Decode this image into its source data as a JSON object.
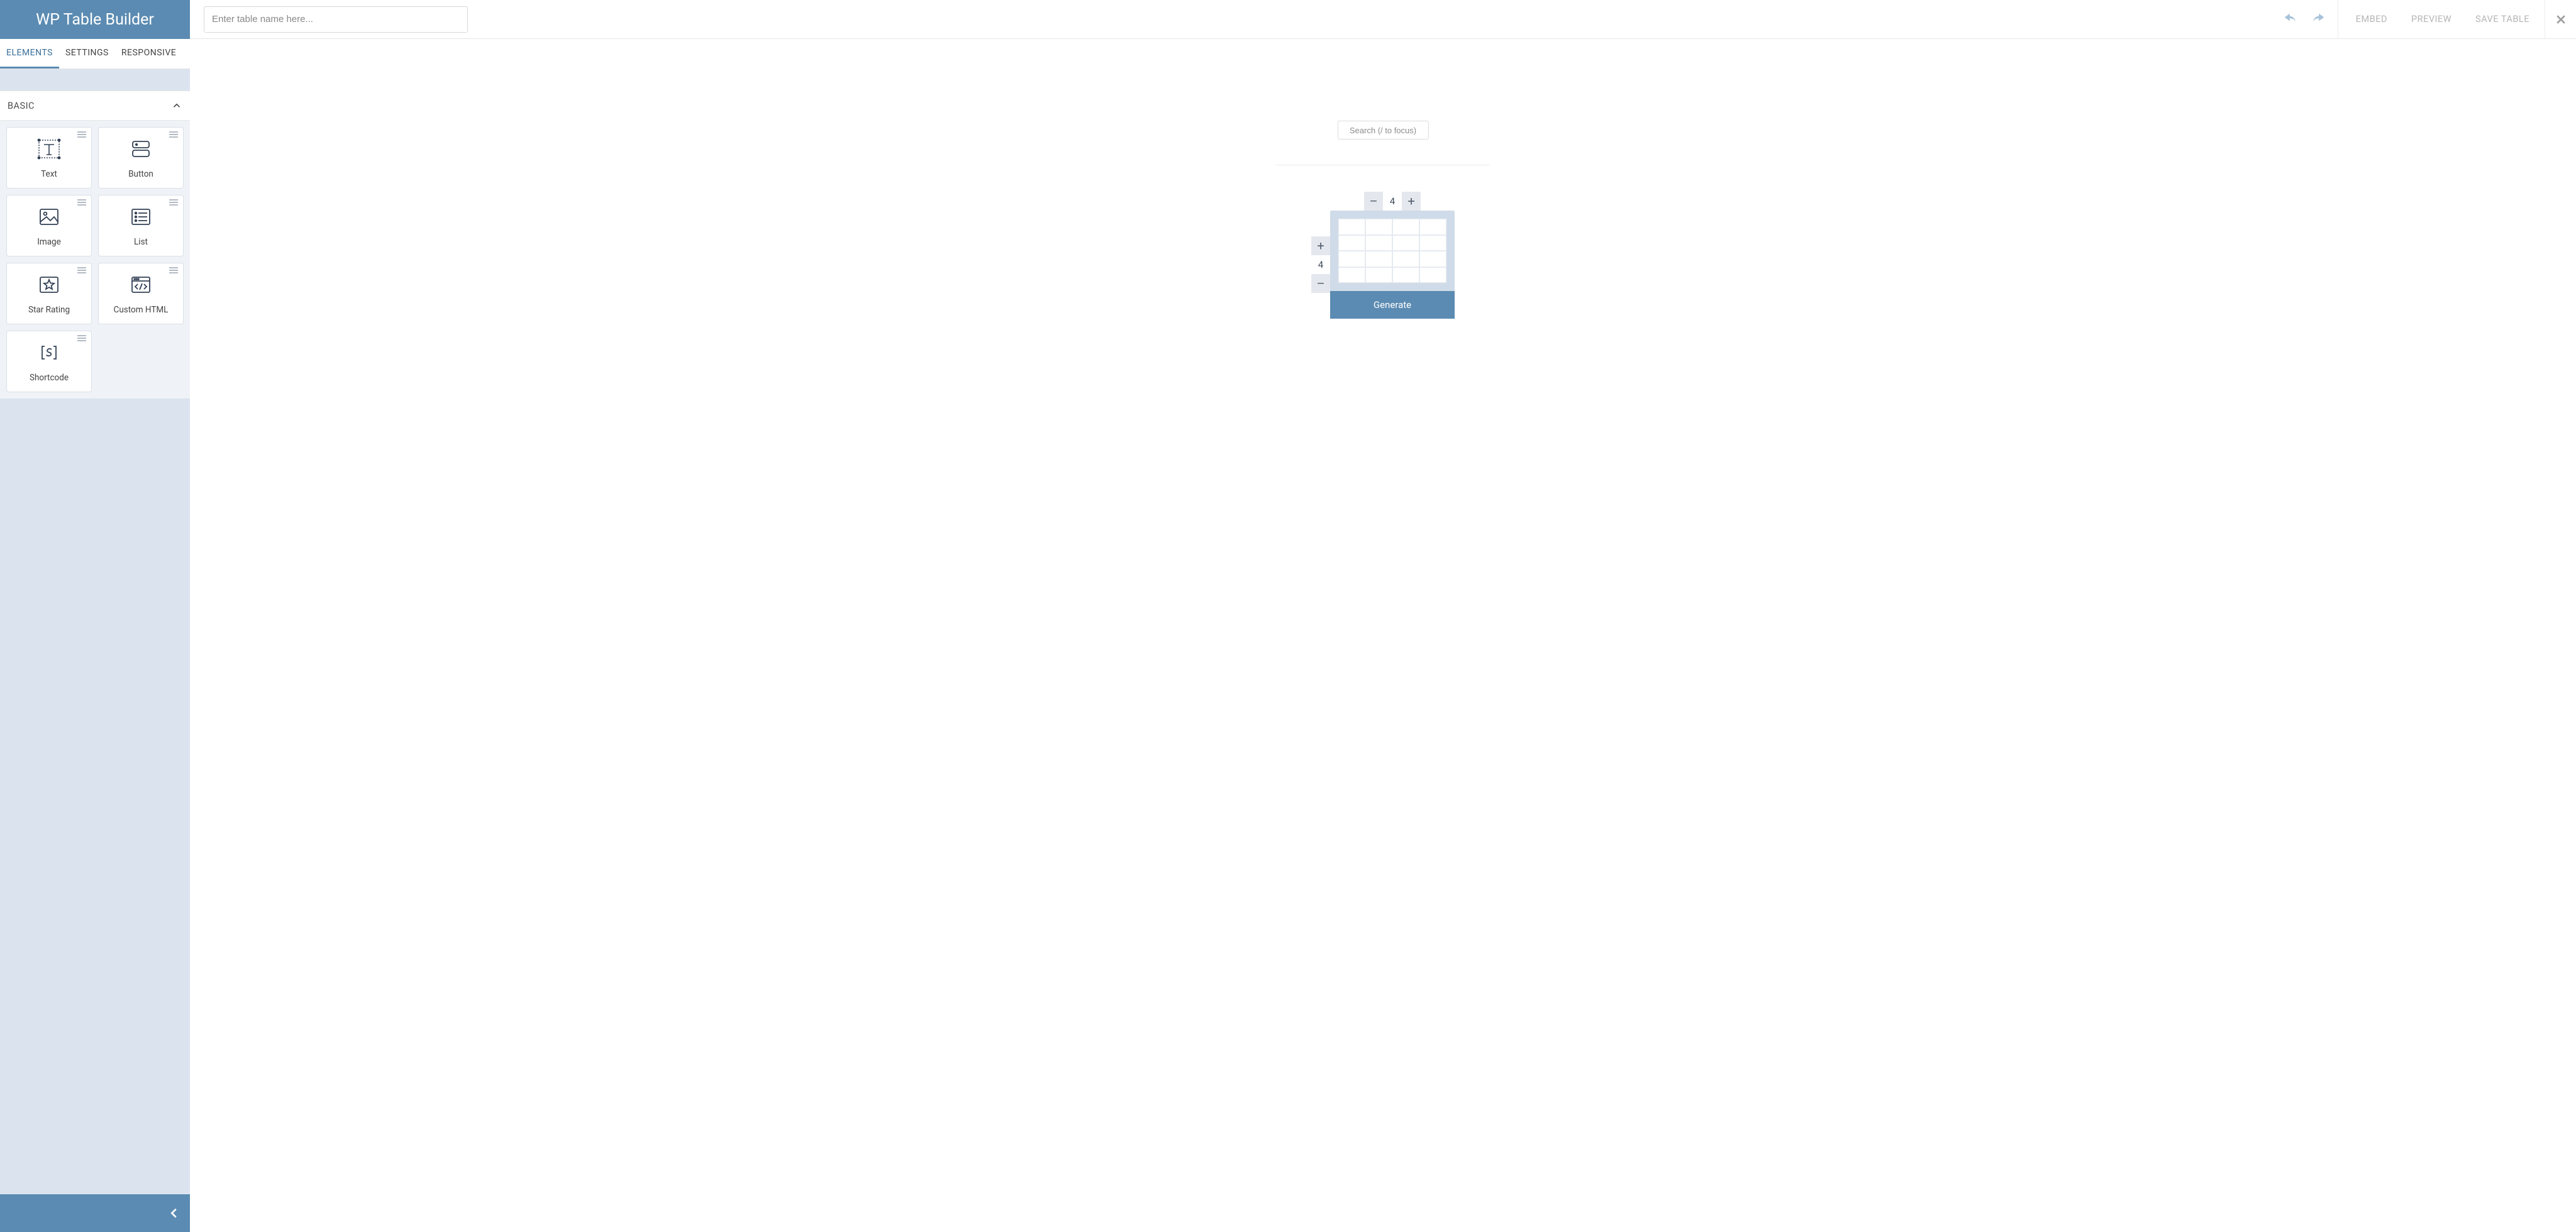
{
  "app": {
    "title": "WP Table Builder"
  },
  "sidebar": {
    "tabs": {
      "elements": "ELEMENTS",
      "settings": "SETTINGS",
      "responsive": "RESPONSIVE"
    },
    "panel_title": "BASIC",
    "elements": {
      "text": "Text",
      "button": "Button",
      "image": "Image",
      "list": "List",
      "star_rating": "Star Rating",
      "custom_html": "Custom HTML",
      "shortcode": "Shortcode"
    }
  },
  "topbar": {
    "title_placeholder": "Enter table name here...",
    "embed": "EMBED",
    "preview": "PREVIEW",
    "save": "SAVE TABLE"
  },
  "canvas": {
    "search_placeholder": "Search (/ to focus)",
    "generator": {
      "cols": "4",
      "rows": "4",
      "plus": "+",
      "minus": "–",
      "generate": "Generate"
    }
  }
}
